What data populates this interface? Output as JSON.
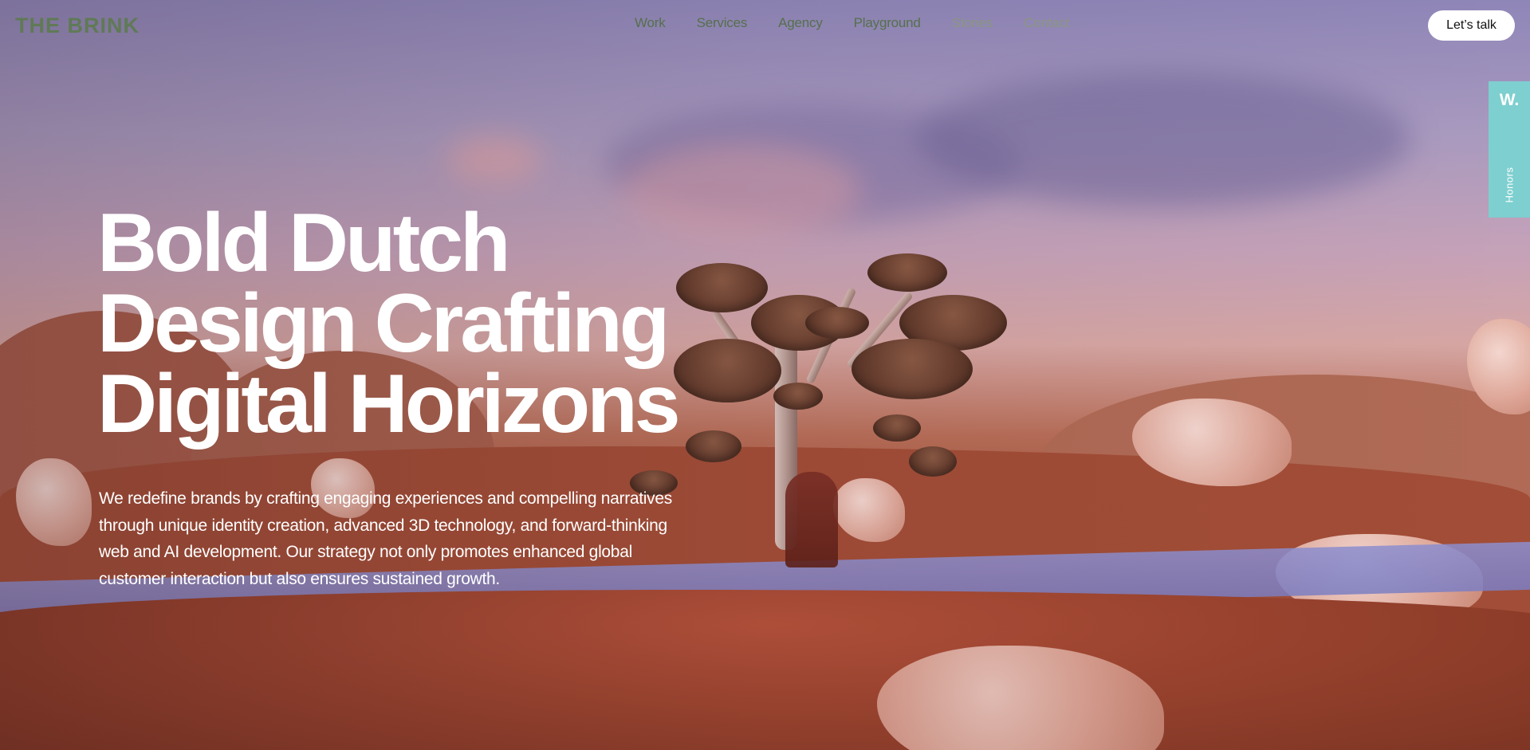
{
  "header": {
    "logo": "THE BRINK",
    "nav": [
      {
        "label": "Work"
      },
      {
        "label": "Services"
      },
      {
        "label": "Agency"
      },
      {
        "label": "Playground"
      },
      {
        "label": "Stories"
      },
      {
        "label": "Contact"
      }
    ],
    "cta_label": "Let’s talk"
  },
  "honors_tab": {
    "logo": "W.",
    "label": "Honors"
  },
  "hero": {
    "title_lines": [
      "Bold Dutch",
      "Design Crafting",
      "Digital Horizons"
    ],
    "description": "We redefine brands by crafting engaging experiences and compelling narratives through unique identity creation, advanced 3D technology, and forward-thinking web and AI development. Our strategy not only promotes enhanced global customer interaction but also ensures sustained growth."
  },
  "colors": {
    "logo": "#5f7a55",
    "nav_text": "#55704c",
    "honors_bg": "#7ecfcf",
    "cta_bg": "#ffffff",
    "hero_text": "#ffffff"
  }
}
